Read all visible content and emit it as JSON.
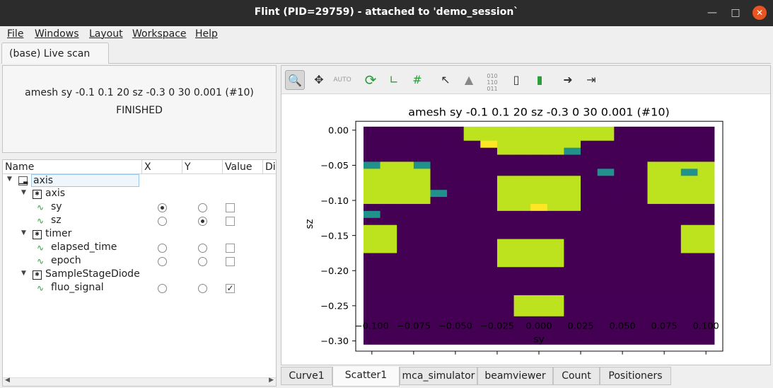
{
  "window": {
    "title": "Flint (PID=29759) - attached to 'demo_session`"
  },
  "menu": [
    "File",
    "Windows",
    "Layout",
    "Workspace",
    "Help"
  ],
  "top_tab": "(base) Live scan",
  "status": {
    "command": "amesh sy -0.1 0.1 20 sz -0.3 0 30 0.001 (#10)",
    "state": "FINISHED"
  },
  "tree": {
    "headers": [
      "Name",
      "X",
      "Y",
      "Value",
      "Di:"
    ],
    "rows": [
      {
        "label": "axis",
        "level": 0,
        "kind": "group"
      },
      {
        "label": "axis",
        "level": 1,
        "kind": "device"
      },
      {
        "label": "sy",
        "level": 2,
        "kind": "channel",
        "x": true,
        "y": false,
        "value": false
      },
      {
        "label": "sz",
        "level": 2,
        "kind": "channel",
        "x": false,
        "y": true,
        "value": false
      },
      {
        "label": "timer",
        "level": 1,
        "kind": "device"
      },
      {
        "label": "elapsed_time",
        "level": 2,
        "kind": "channel",
        "x": false,
        "y": false,
        "value": false
      },
      {
        "label": "epoch",
        "level": 2,
        "kind": "channel",
        "x": false,
        "y": false,
        "value": false
      },
      {
        "label": "SampleStageDiode",
        "level": 1,
        "kind": "device"
      },
      {
        "label": "fluo_signal",
        "level": 2,
        "kind": "channel",
        "x": false,
        "y": false,
        "value": true
      }
    ]
  },
  "toolbar_icons": [
    "zoom-icon",
    "pan-icon",
    "autoscale-icon",
    "refresh-icon",
    "axis-icon",
    "grid-icon",
    "crosshair-icon",
    "histogram-icon",
    "binary-icon",
    "colormap-icon",
    "colorbar-icon",
    "export-icon",
    "import-icon"
  ],
  "bottom_tabs": [
    "Curve1",
    "Scatter1",
    "mca_simulator",
    "beamviewer",
    "Count",
    "Positioners"
  ],
  "selected_bottom_tab": "Scatter1",
  "chart_data": {
    "type": "heatmap",
    "title": "amesh sy -0.1 0.1 20 sz -0.3 0 30 0.001 (#10)",
    "xlabel": "sy",
    "ylabel": "sz",
    "xlim": [
      -0.105,
      0.105
    ],
    "ylim": [
      -0.305,
      0.005
    ],
    "x_ticks": [
      "−0.100",
      "−0.075",
      "−0.050",
      "−0.025",
      "0.000",
      "0.025",
      "0.050",
      "0.075",
      "0.100"
    ],
    "y_ticks": [
      "0.00",
      "−0.05",
      "−0.10",
      "−0.15",
      "−0.20",
      "−0.25",
      "−0.30"
    ],
    "x_tick_values": [
      -0.1,
      -0.075,
      -0.05,
      -0.025,
      0,
      0.025,
      0.05,
      0.075,
      0.1
    ],
    "y_tick_values": [
      0,
      -0.05,
      -0.1,
      -0.15,
      -0.2,
      -0.25,
      -0.3
    ],
    "colors": {
      "low": "#440154",
      "mid1": "#3b528b",
      "mid2": "#21918c",
      "high": "#bde21e",
      "top": "#fde725"
    },
    "x": [
      -0.1,
      -0.09,
      -0.08,
      -0.07,
      -0.06,
      -0.05,
      -0.04,
      -0.03,
      -0.02,
      -0.01,
      0.0,
      0.01,
      0.02,
      0.03,
      0.04,
      0.05,
      0.06,
      0.07,
      0.08,
      0.09,
      0.1
    ],
    "blobs": [
      {
        "sy": [
          -0.045,
          0.045
        ],
        "sz": [
          -0.015,
          0.0
        ]
      },
      {
        "sy": [
          -0.025,
          0.025
        ],
        "sz": [
          -0.03,
          -0.015
        ]
      },
      {
        "sy": [
          -0.1,
          -0.065
        ],
        "sz": [
          -0.1,
          -0.05
        ]
      },
      {
        "sy": [
          0.065,
          0.1
        ],
        "sz": [
          -0.1,
          -0.05
        ]
      },
      {
        "sy": [
          -0.025,
          0.025
        ],
        "sz": [
          -0.115,
          -0.065
        ]
      },
      {
        "sy": [
          -0.1,
          -0.09
        ],
        "sz": [
          -0.175,
          -0.135
        ]
      },
      {
        "sy": [
          0.09,
          0.1
        ],
        "sz": [
          -0.175,
          -0.135
        ]
      },
      {
        "sy": [
          -0.025,
          0.015
        ],
        "sz": [
          -0.195,
          -0.155
        ]
      },
      {
        "sy": [
          -0.015,
          0.015
        ],
        "sz": [
          -0.265,
          -0.235
        ]
      }
    ]
  }
}
